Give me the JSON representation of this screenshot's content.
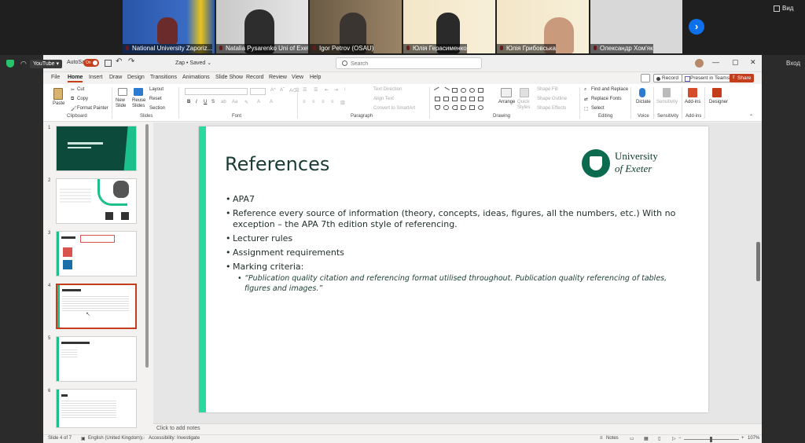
{
  "zoom": {
    "participants": [
      {
        "name": "National University Zaporiz..."
      },
      {
        "name": "Natalia Pysarenko Uni of Exet..."
      },
      {
        "name": "Igor Petrov (OSAU)"
      },
      {
        "name": "Юлія Герасименко"
      },
      {
        "name": "Юлія Грибовська"
      },
      {
        "name": "Олександр Хом'як"
      }
    ],
    "view_label": "Вид",
    "signin_label": "Вход",
    "next_symbol": "›"
  },
  "browser": {
    "youtube_label": "YouTube ▾"
  },
  "titlebar": {
    "autosave_label": "AutoSave",
    "autosave_state": "On",
    "file_title": "Zap • Saved ⌄",
    "search_placeholder": "Search",
    "min": "—",
    "max": "▢",
    "close": "✕"
  },
  "ribbon_tabs": [
    "File",
    "Home",
    "Insert",
    "Draw",
    "Design",
    "Transitions",
    "Animations",
    "Slide Show",
    "Record",
    "Review",
    "View",
    "Help"
  ],
  "ribbon_actions": {
    "record": "Record",
    "teams": "Present in Teams",
    "share": "Share"
  },
  "ribbon": {
    "clipboard": {
      "paste": "Paste",
      "cut": "Cut",
      "copy": "Copy",
      "format_painter": "Format Painter",
      "label": "Clipboard"
    },
    "slides": {
      "new_slide": "New Slide",
      "reuse": "Reuse Slides",
      "layout": "Layout",
      "reset": "Reset",
      "section": "Section",
      "label": "Slides"
    },
    "font": {
      "label": "Font"
    },
    "paragraph": {
      "text_direction": "Text Direction",
      "align_text": "Align Text",
      "smartart": "Convert to SmartArt",
      "label": "Paragraph"
    },
    "drawing": {
      "arrange": "Arrange",
      "quick_styles": "Quick Styles",
      "shape_fill": "Shape Fill",
      "shape_outline": "Shape Outline",
      "shape_effects": "Shape Effects",
      "label": "Drawing"
    },
    "editing": {
      "find": "Find and Replace",
      "replace": "Replace Fonts",
      "select": "Select",
      "label": "Editing"
    },
    "voice": {
      "dictate": "Dictate",
      "label": "Voice"
    },
    "sensitivity": {
      "button": "Sensitivity",
      "label": "Sensitivity"
    },
    "addins": {
      "button": "Add-ins",
      "label": "Add-ins"
    },
    "designer": {
      "button": "Designer"
    }
  },
  "thumbnails": [
    {
      "num": "1"
    },
    {
      "num": "2"
    },
    {
      "num": "3"
    },
    {
      "num": "4"
    },
    {
      "num": "5"
    },
    {
      "num": "6"
    }
  ],
  "slide": {
    "title": "References",
    "logo_line1": "University",
    "logo_line2": "of Exeter",
    "bullets": [
      "APA7",
      "Reference every source of information (theory, concepts, ideas, figures, all the numbers, etc.) With no exception – the APA 7th edition style of referencing.",
      "Lecturer rules",
      "Assignment requirements",
      "Marking criteria:"
    ],
    "sub_bullet": "“Publication quality citation and referencing format utilised throughout. Publication quality referencing of tables, figures and images.”"
  },
  "notes_placeholder": "Click to add notes",
  "status": {
    "slide_count": "Slide 4 of 7",
    "language": "English (United Kingdom)",
    "accessibility": "Accessibility: Investigate",
    "notes": "Notes",
    "zoom": "107%"
  }
}
